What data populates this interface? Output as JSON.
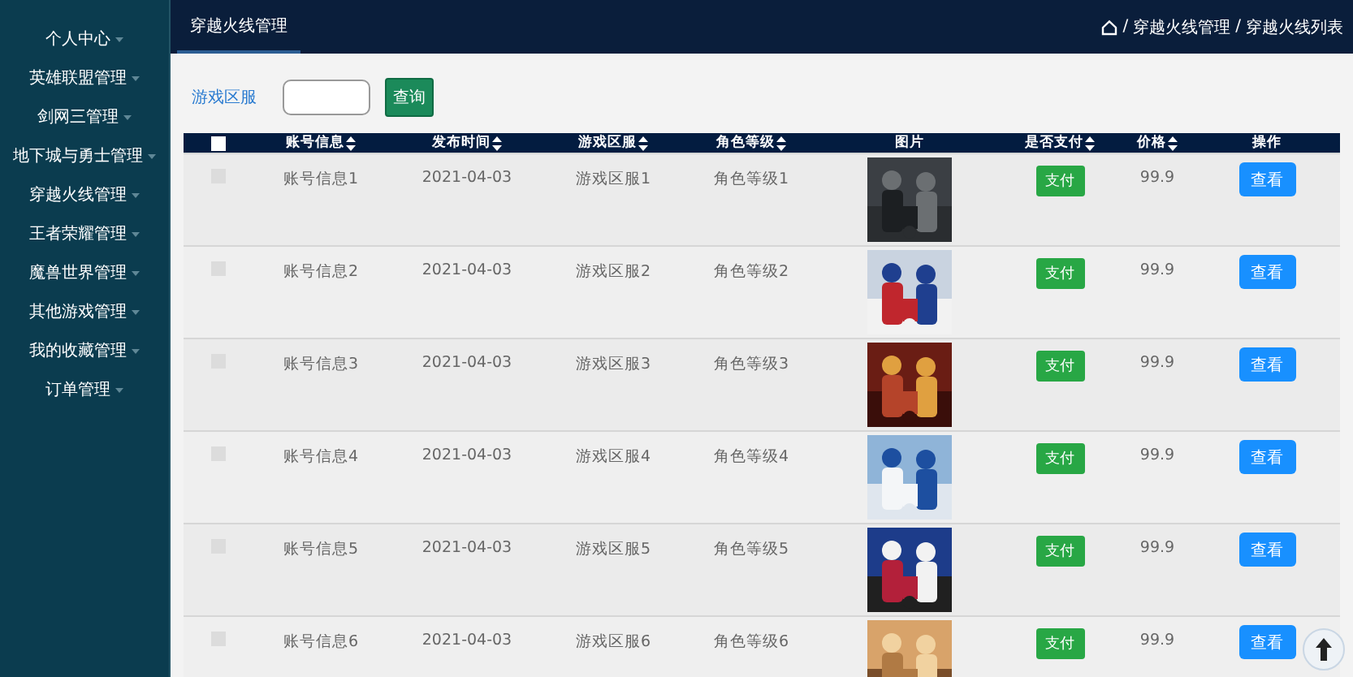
{
  "sidebar": {
    "items": [
      {
        "label": "个人中心",
        "selected": false
      },
      {
        "label": "英雄联盟管理",
        "selected": false
      },
      {
        "label": "剑网三管理",
        "selected": false
      },
      {
        "label": "地下城与勇士管理",
        "selected": false
      },
      {
        "label": "穿越火线管理",
        "selected": false
      },
      {
        "label": "王者荣耀管理",
        "selected": false
      },
      {
        "label": "魔兽世界管理",
        "selected": false
      },
      {
        "label": "其他游戏管理",
        "selected": false
      },
      {
        "label": "我的收藏管理",
        "selected": false
      },
      {
        "label": "订单管理",
        "selected": false
      }
    ]
  },
  "topbar": {
    "tabs": [
      {
        "label": "穿越火线管理",
        "selected": true
      }
    ],
    "breadcrumb_separator": "/",
    "breadcrumb": [
      "穿越火线管理",
      "穿越火线列表"
    ]
  },
  "search": {
    "label": "游戏区服",
    "button": "查询"
  },
  "table": {
    "select_all_checked": false,
    "columns": [
      {
        "label": "账号信息",
        "sortable": true
      },
      {
        "label": "发布时间",
        "sortable": true
      },
      {
        "label": "游戏区服",
        "sortable": true
      },
      {
        "label": "角色等级",
        "sortable": true
      },
      {
        "label": "图片",
        "sortable": false
      },
      {
        "label": "是否支付",
        "sortable": true
      },
      {
        "label": "价格",
        "sortable": true
      },
      {
        "label": "操作",
        "sortable": false
      }
    ],
    "rows": [
      {
        "checked": false,
        "account": "账号信息1",
        "date": "2021-04-03",
        "server": "游戏区服1",
        "level_text": "角色等级1",
        "pay": "支付",
        "price": "99.9",
        "action": "查看"
      },
      {
        "checked": false,
        "account": "账号信息2",
        "date": "2021-04-03",
        "server": "游戏区服2",
        "level_text": "角色等级2",
        "pay": "支付",
        "price": "99.9",
        "action": "查看"
      },
      {
        "checked": false,
        "account": "账号信息3",
        "date": "2021-04-03",
        "server": "游戏区服3",
        "level_text": "角色等级3",
        "pay": "支付",
        "price": "99.9",
        "action": "查看"
      },
      {
        "checked": false,
        "account": "账号信息4",
        "date": "2021-04-03",
        "server": "游戏区服4",
        "level_text": "角色等级4",
        "pay": "支付",
        "price": "99.9",
        "action": "查看"
      },
      {
        "checked": false,
        "account": "账号信息5",
        "date": "2021-04-03",
        "server": "游戏区服5",
        "level_text": "角色等级5",
        "pay": "支付",
        "price": "99.9",
        "action": "查看"
      },
      {
        "checked": false,
        "account": "账号信息6",
        "date": "2021-04-03",
        "server": "游戏区服6",
        "level_text": "角色等级6",
        "pay": "支付",
        "price": "99.9",
        "action": "查看"
      }
    ]
  }
}
